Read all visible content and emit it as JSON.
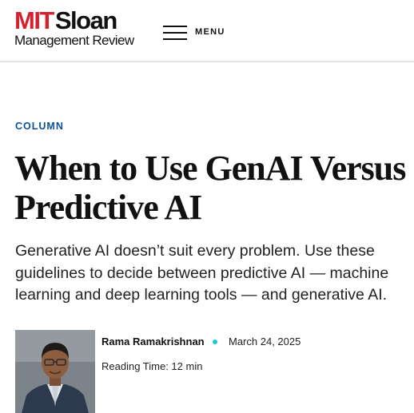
{
  "header": {
    "logo": {
      "part1": "MIT",
      "part2": "Sloan",
      "subtitle": "Management Review",
      "brand_color": "#d5202e"
    },
    "menu_label": "MENU"
  },
  "article": {
    "category": "COLUMN",
    "category_color": "#0b5394",
    "title": "When to Use GenAI Versus Predictive AI",
    "dek": "Generative AI doesn’t suit every problem. Use these guidelines to decide between predictive AI — machine learning and deep learning tools — and generative AI.",
    "author": {
      "name": "Rama Ramakrishnan",
      "photo": "author-portrait"
    },
    "separator_color": "#1ec8d6",
    "date": "March 24, 2025",
    "reading_time": "Reading Time: 12 min"
  }
}
